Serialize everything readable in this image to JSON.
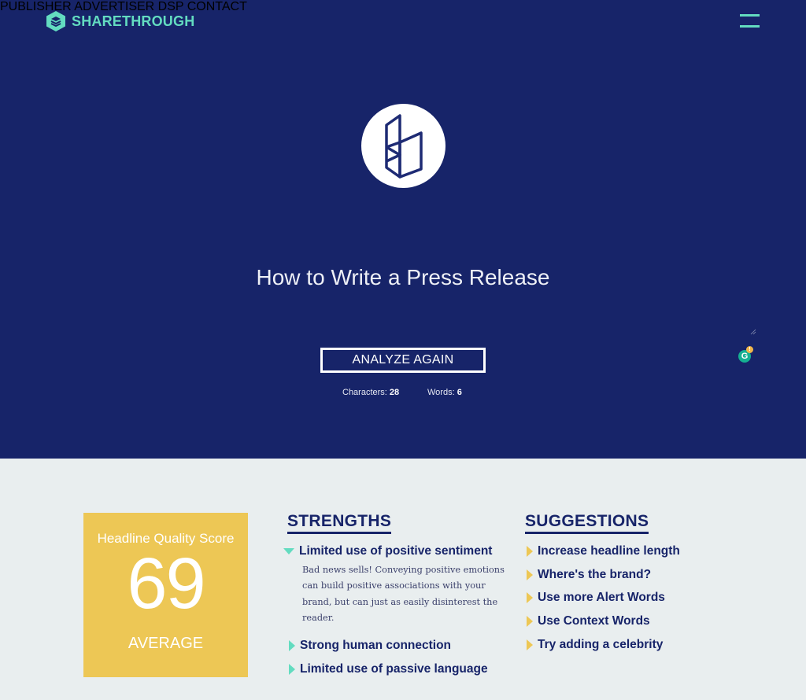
{
  "brand": {
    "name": "SHARETHROUGH",
    "icon": "sharethrough-hexagon-icon"
  },
  "nav": {
    "items": [
      {
        "label": "PUBLISHER"
      },
      {
        "label": "ADVERTISER"
      },
      {
        "label": "DSP"
      },
      {
        "label": "CONTACT"
      }
    ],
    "menu_icon": "hamburger-menu-icon"
  },
  "hero": {
    "logo_icon": "headline-analyzer-logo-icon",
    "headline_value": "How to Write a Press Release",
    "analyze_label": "ANALYZE AGAIN",
    "characters_label": "Characters:",
    "characters_value": "28",
    "words_label": "Words:",
    "words_value": "6",
    "grammarly_letter": "G",
    "grammarly_badge": "!"
  },
  "score": {
    "label": "Headline Quality Score",
    "value": "69",
    "rating": "AVERAGE"
  },
  "strengths": {
    "title": "STRENGTHS",
    "items": [
      {
        "label": "Limited use of positive sentiment",
        "expanded": true,
        "description": "Bad news sells! Conveying positive emotions can build positive associations with your brand, but can just as easily disinterest the reader."
      },
      {
        "label": "Strong human connection",
        "expanded": false
      },
      {
        "label": "Limited use of passive language",
        "expanded": false
      }
    ]
  },
  "suggestions": {
    "title": "SUGGESTIONS",
    "items": [
      {
        "label": "Increase headline length"
      },
      {
        "label": "Where's the brand?"
      },
      {
        "label": "Use more Alert Words"
      },
      {
        "label": "Use Context Words"
      },
      {
        "label": "Try adding a celebrity"
      }
    ]
  },
  "colors": {
    "navy": "#172469",
    "mint": "#63dcc0",
    "yellow": "#edc755",
    "light_bg": "#e9eeef"
  }
}
